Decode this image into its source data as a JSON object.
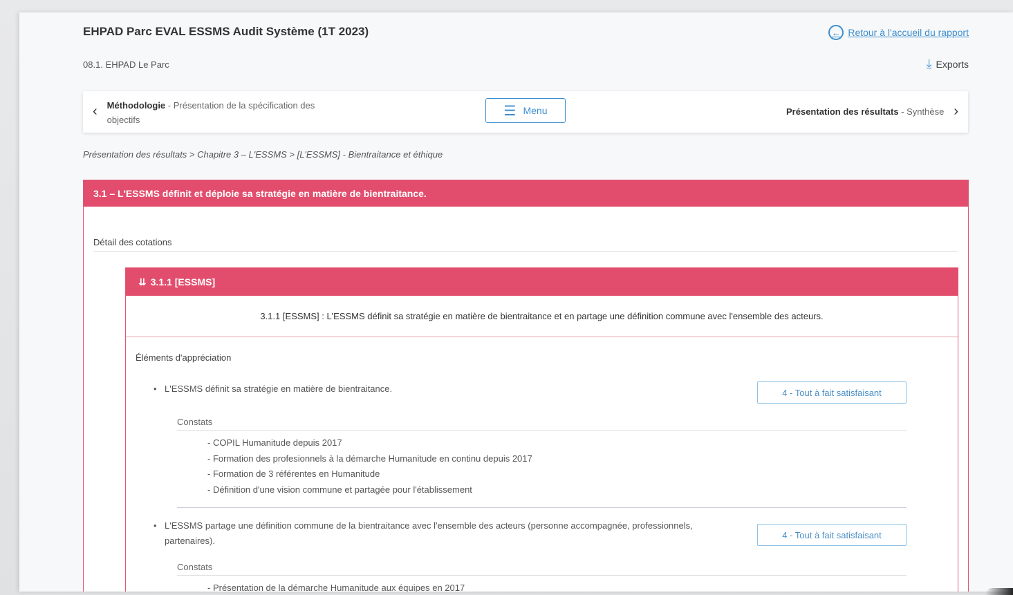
{
  "header": {
    "title": "EHPAD Parc EVAL ESSMS Audit Système (1T 2023)",
    "back_link": "Retour à l'accueil du rapport",
    "subtitle": "08.1. EHPAD Le Parc",
    "exports": "Exports"
  },
  "nav": {
    "prev_bold": "Méthodologie",
    "prev_rest": " - Présentation de la spécification des objectifs",
    "menu": "Menu",
    "next_bold": "Présentation des résultats",
    "next_rest": " - Synthèse"
  },
  "breadcrumb": "Présentation des résultats > Chapitre 3 – L'ESSMS > [L'ESSMS] - Bientraitance et éthique",
  "section": {
    "title": "3.1 – L'ESSMS définit et déploie sa stratégie en matière de bientraitance.",
    "detail_title": "Détail des cotations",
    "sub": {
      "title": "3.1.1 [ESSMS]",
      "description": "3.1.1 [ESSMS] : L'ESSMS définit sa stratégie en matière de bientraitance et en partage une définition commune avec l'ensemble des acteurs.",
      "elements_title": "Éléments d'appréciation",
      "criteria": [
        {
          "text": "L'ESSMS définit sa stratégie en matière de bientraitance.",
          "rating": "4 - Tout à fait satisfaisant",
          "constats_title": "Constats",
          "constats": [
            "COPIL Humanitude depuis 2017",
            "Formation des profesionnels à la démarche Humanitude en continu depuis 2017",
            "Formation de 3 référentes en Humanitude",
            "Définition d'une vision commune et partagée pour l'établissement"
          ]
        },
        {
          "text": "L'ESSMS partage une définition commune de la bientraitance avec l'ensemble des acteurs (personne accompagnée, professionnels, partenaires).",
          "rating": "4 - Tout à fait satisfaisant",
          "constats_title": "Constats",
          "constats": [
            "Présentation de la démarche Humanitude aux équipes en 2017"
          ]
        }
      ]
    }
  },
  "icons": {
    "back": "arrow-left-circle-icon",
    "exports": "download-icon",
    "prev": "chevron-left-icon",
    "next": "chevron-right-icon",
    "menu": "hamburger-icon",
    "collapse": "double-chevron-down-icon"
  },
  "colors": {
    "accent": "#e24d6d",
    "link": "#3b8ecf"
  }
}
